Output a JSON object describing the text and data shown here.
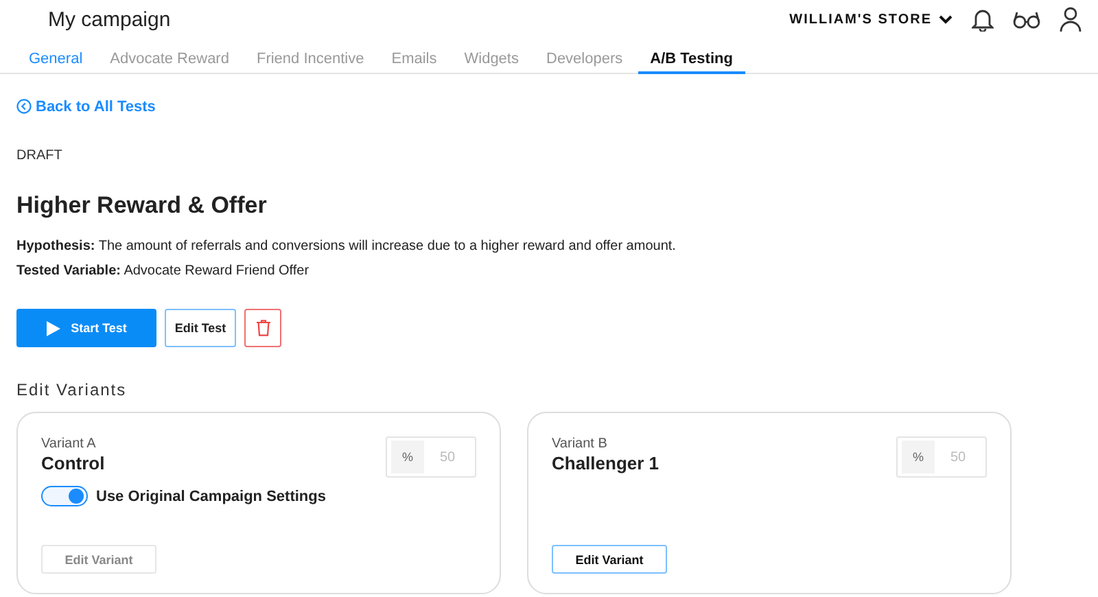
{
  "header": {
    "title": "My campaign",
    "store": "WILLIAM'S STORE"
  },
  "tabs": [
    {
      "label": "General",
      "selected": false,
      "kind": "link"
    },
    {
      "label": "Advocate Reward",
      "selected": false,
      "kind": "plain"
    },
    {
      "label": "Friend Incentive",
      "selected": false,
      "kind": "plain"
    },
    {
      "label": "Emails",
      "selected": false,
      "kind": "plain"
    },
    {
      "label": "Widgets",
      "selected": false,
      "kind": "plain"
    },
    {
      "label": "Developers",
      "selected": false,
      "kind": "plain"
    },
    {
      "label": "A/B Testing",
      "selected": true,
      "kind": "plain"
    }
  ],
  "back_link": "Back to All Tests",
  "status": "DRAFT",
  "test": {
    "title": "Higher Reward & Offer",
    "hypothesis": "**Hypothesis:** The amount of referrals and conversions will increase due to a higher reward and offer amount.",
    "tested_variable": "**Tested Variable:** Advocate Reward Friend Offer"
  },
  "actions": {
    "start": "Start Test",
    "edit": "Edit Test"
  },
  "variants_heading": "Edit Variants",
  "variants": [
    {
      "label": "Variant A",
      "name": "Control",
      "unit": "%",
      "percent": "50",
      "toggle": {
        "label": "Use Original Campaign Settings",
        "on": true
      },
      "button": "Edit Variant",
      "disabled": true
    },
    {
      "label": "Variant B",
      "name": "Challenger 1",
      "unit": "%",
      "percent": "50",
      "button": "Edit Variant",
      "disabled": false
    }
  ]
}
